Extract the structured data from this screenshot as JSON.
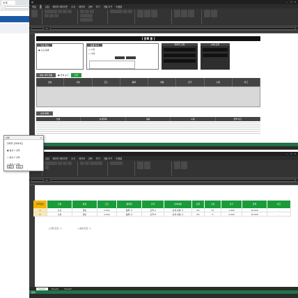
{
  "browser": {
    "tab_label": "새 탭"
  },
  "top_window": {
    "menu": [
      "파일",
      "홈",
      "삽입",
      "페이지 레이아웃",
      "수식",
      "데이터",
      "검토",
      "보기",
      "개발 도구",
      "도움말"
    ],
    "active_menu": "홈",
    "form_title": "[ 등록 폼 ]",
    "section_labels": {
      "basic_info": "기초 정보",
      "method": "등록 방식",
      "lookup1": "데이터 조회",
      "lookup2": "상세 조회"
    },
    "radio_options": [
      "신규 등록",
      "수정",
      "삭제"
    ],
    "list_label": "대상 내역 현황",
    "list_option": "전체 보기",
    "list_button": "조회",
    "table_headers": [
      "번호",
      "구분",
      "코드",
      "품목",
      "내용",
      "단가",
      "수량",
      "비고"
    ],
    "detail_label": "상세 목록",
    "detail_headers": [
      "번호",
      "상세항목",
      "내용",
      "수량",
      "금액 비고"
    ],
    "status": "준비"
  },
  "dialog": {
    "title": "선택",
    "close": "×",
    "options": [
      "항목을 선택하세요",
      "● 옵션 1 선택",
      "○ 옵션 2 선택",
      "○ 옵션 3 선택"
    ],
    "ok": "확인",
    "cancel": "취소"
  },
  "bottom_window": {
    "menu": [
      "파일",
      "홈",
      "삽입",
      "페이지 레이아웃",
      "수식",
      "데이터",
      "검토",
      "보기",
      "개발 도구",
      "도움말"
    ],
    "active_menu": "홈",
    "info_line1": "[ 조회 조건 : ]",
    "info_line2": "[ 상세 조건 : ]",
    "table_headers": [
      "관리번호",
      "구분",
      "분류",
      "코드",
      "품목명",
      "규격",
      "상세내용",
      "단위",
      "수량",
      "단가",
      "금액",
      "비고"
    ],
    "rows": [
      [
        "1",
        "신규",
        "일반",
        "A-001",
        "품목 가",
        "규격 A",
        "상세 내용 가",
        "EA",
        "10",
        "1,000",
        "10,000",
        "-"
      ],
      [
        "2",
        "수정",
        "일반",
        "A-002",
        "품목 나",
        "규격 B",
        "상세 내용 나",
        "EA",
        "5",
        "2,000",
        "10,000",
        "-"
      ]
    ],
    "sheets": [
      "Sheet1",
      "Sheet2",
      "Sheet3"
    ],
    "active_sheet": "Sheet1",
    "status": "준비"
  },
  "colors": {
    "excel_dark": "#2b2b2b",
    "header_green": "#1a9c3a",
    "header_gold": "#f1b400",
    "status_green": "#217346"
  }
}
